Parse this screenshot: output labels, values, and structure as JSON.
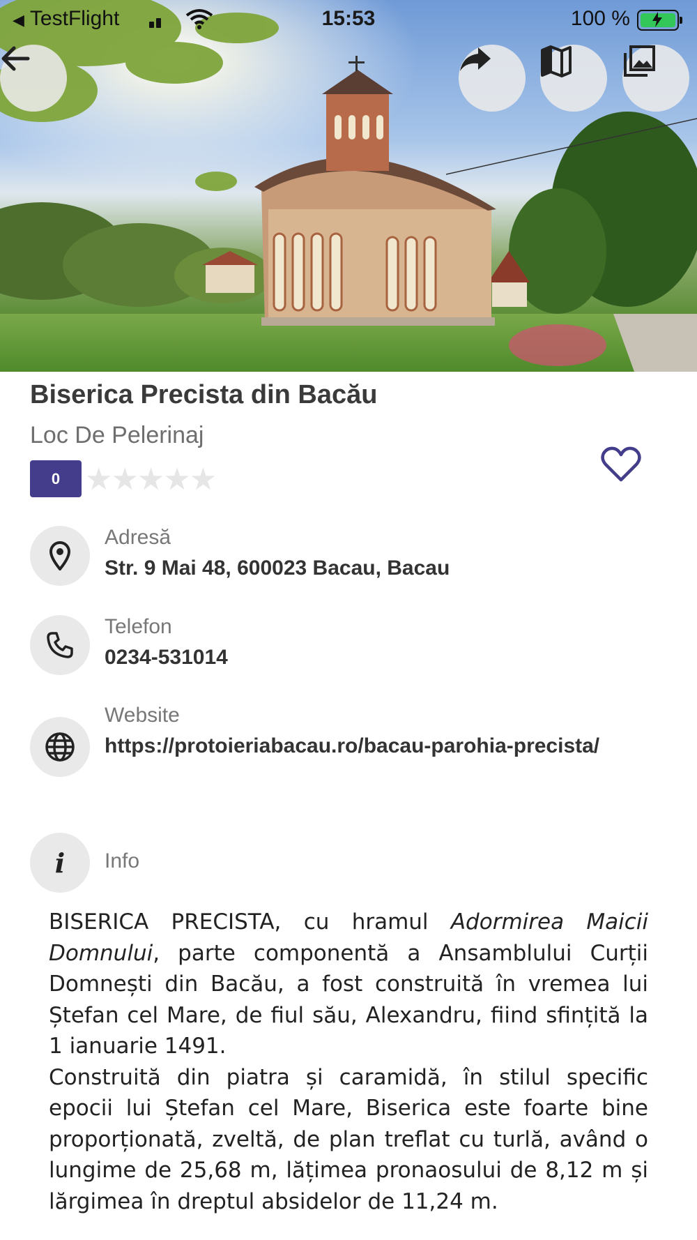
{
  "status_bar": {
    "back_app": "TestFlight",
    "time": "15:53",
    "battery": "100 %"
  },
  "header": {
    "back_icon": "arrow-left-icon",
    "share_icon": "share-icon",
    "map_icon": "map-icon",
    "gallery_icon": "gallery-icon"
  },
  "place": {
    "title": "Biserica Precista din Bacău",
    "category": "Loc De Pelerinaj",
    "rating_value": "0",
    "stars": "★★★★★",
    "rating_fraction": 0
  },
  "details": {
    "address": {
      "label": "Adresă",
      "value": "Str. 9 Mai 48, 600023 Bacau, Bacau"
    },
    "phone": {
      "label": "Telefon",
      "value": "0234-531014"
    },
    "website": {
      "label": "Website",
      "value": "https://protoieriabacau.ro/bacau-parohia-precista/"
    },
    "info": {
      "label": "Info",
      "icon_glyph": "i"
    }
  },
  "description": {
    "p1_start": "BISERICA PRECISTA, cu hramul ",
    "p1_italic": "Adormirea Maicii Domnului",
    "p1_end": ", parte componentă a Ansamblului Curții Domnești din Bacău, a fost construită în vremea lui Ștefan cel Mare, de fiul său, Alexandru, fiind sfințită la 1 ianuarie 1491.",
    "p2": "Construită din piatra și caramidă, în stilul specific epocii lui Ștefan cel Mare, Biserica este foarte bine proporționată, zveltă, de plan treflat cu turlă, având o lungime de 25,68 m, lățimea pronaosului de 8,12 m și lărgimea în dreptul absidelor de 11,24 m."
  },
  "colors": {
    "accent": "#433d8b",
    "icon_bg": "#e9e9e9",
    "star_empty": "#e6e6e6"
  }
}
